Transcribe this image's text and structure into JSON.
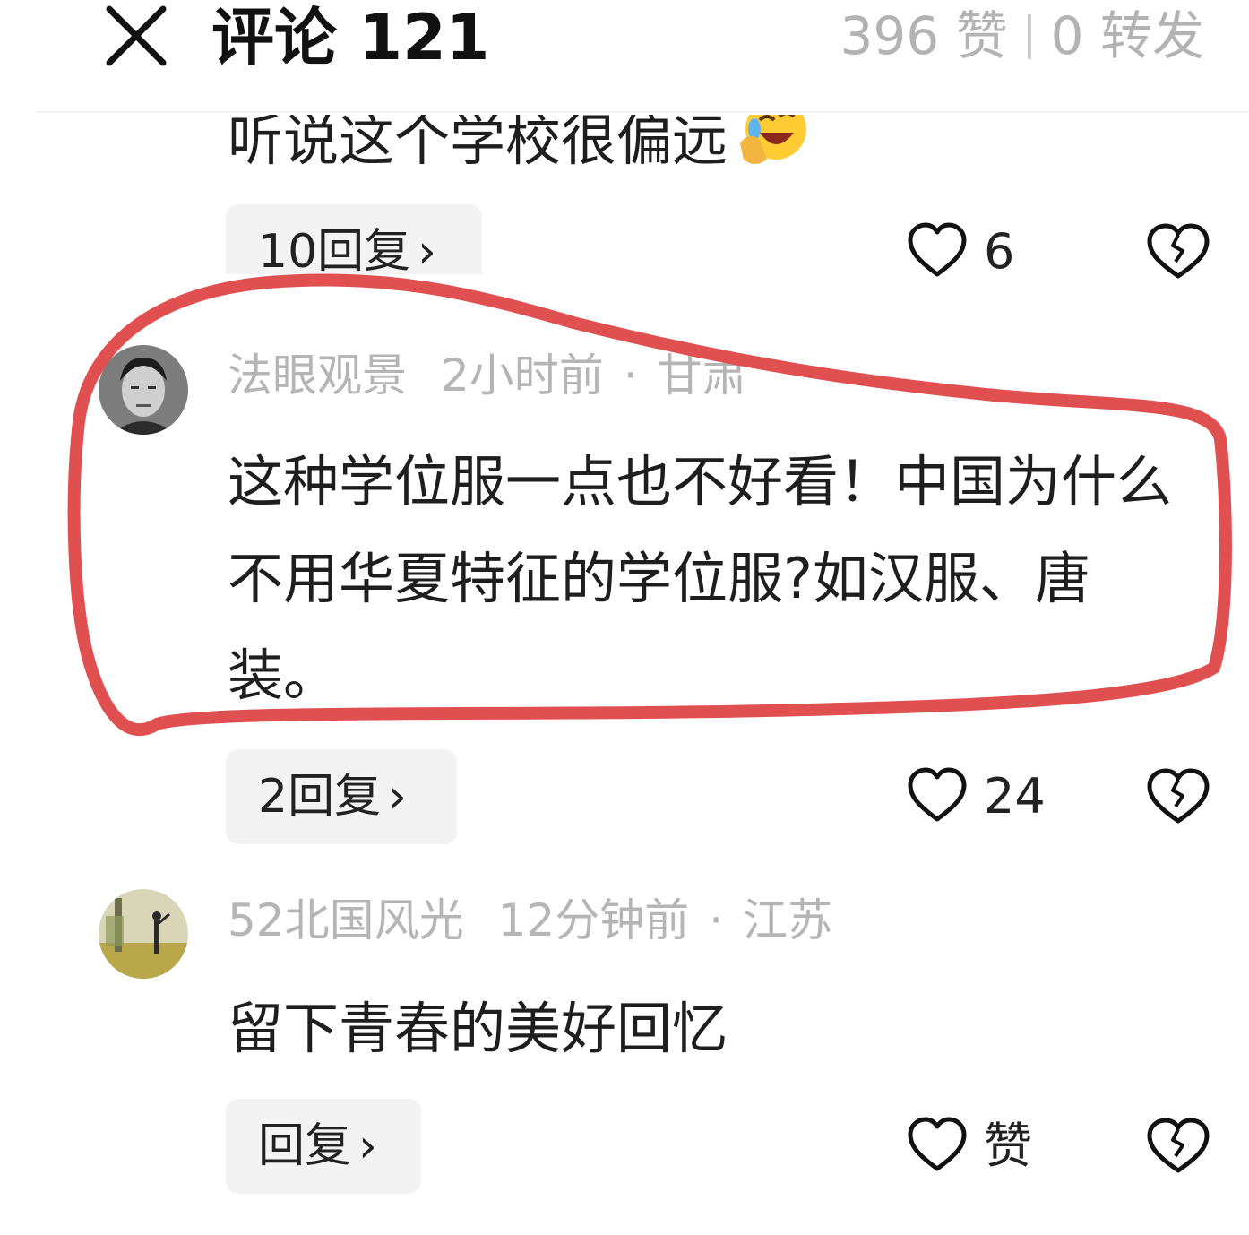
{
  "header": {
    "title": "评论 121",
    "likes_text": "396 赞",
    "shares_text": "0 转发"
  },
  "comments": [
    {
      "text": "听说这个学校很偏远",
      "emoji": "laughing-crying-emoji",
      "reply_label": "10回复",
      "like_count": "6"
    },
    {
      "username": "法眼观景",
      "time": "2小时前",
      "dot": "·",
      "location": "甘肃",
      "text": "这种学位服一点也不好看！中国为什么不用华夏特征的学位服?如汉服、唐装。",
      "reply_label": "2回复",
      "like_count": "24"
    },
    {
      "username": "52北国风光",
      "time": "12分钟前",
      "dot": "·",
      "location": "江苏",
      "text": "留下青春的美好回忆",
      "reply_label": "回复",
      "like_count": "赞"
    }
  ],
  "icons": {
    "close": "close-icon",
    "heart": "heart-icon",
    "dislike": "broken-heart-icon",
    "chevron": "chevron-right-icon"
  },
  "colors": {
    "annotation_outline": "#e05050",
    "meta_text": "#b5b5b5",
    "pill_bg": "#f3f3f3"
  }
}
